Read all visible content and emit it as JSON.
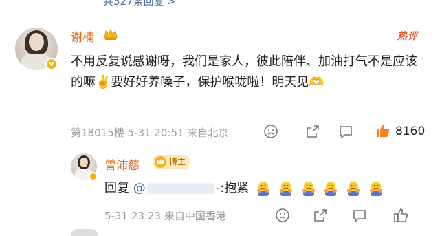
{
  "top_link": {
    "text": "共327条回复 >"
  },
  "comment": {
    "username": "谢楠",
    "hot_badge": "热评",
    "text": "不用反复说感谢呀，我们是家人，彼此陪伴、加油打气不是应该的嘛",
    "text2": "要好好养嗓子，保护喉咙啦！明天见",
    "floor": "第18015楼",
    "date": "5-31 20:51",
    "source": "来自北京",
    "like_count": "8160"
  },
  "reply": {
    "username": "曾沛慈",
    "badge": "博主",
    "prefix": "回复",
    "mention_at": "@",
    "mention_tail": "-:抱紧",
    "date": "5-31 23:23",
    "source": "来自中国香港"
  },
  "colors": {
    "username": "#e06c1b",
    "hot": "#e8542b",
    "meta": "#9a9a9a",
    "like": "#f5821f"
  }
}
